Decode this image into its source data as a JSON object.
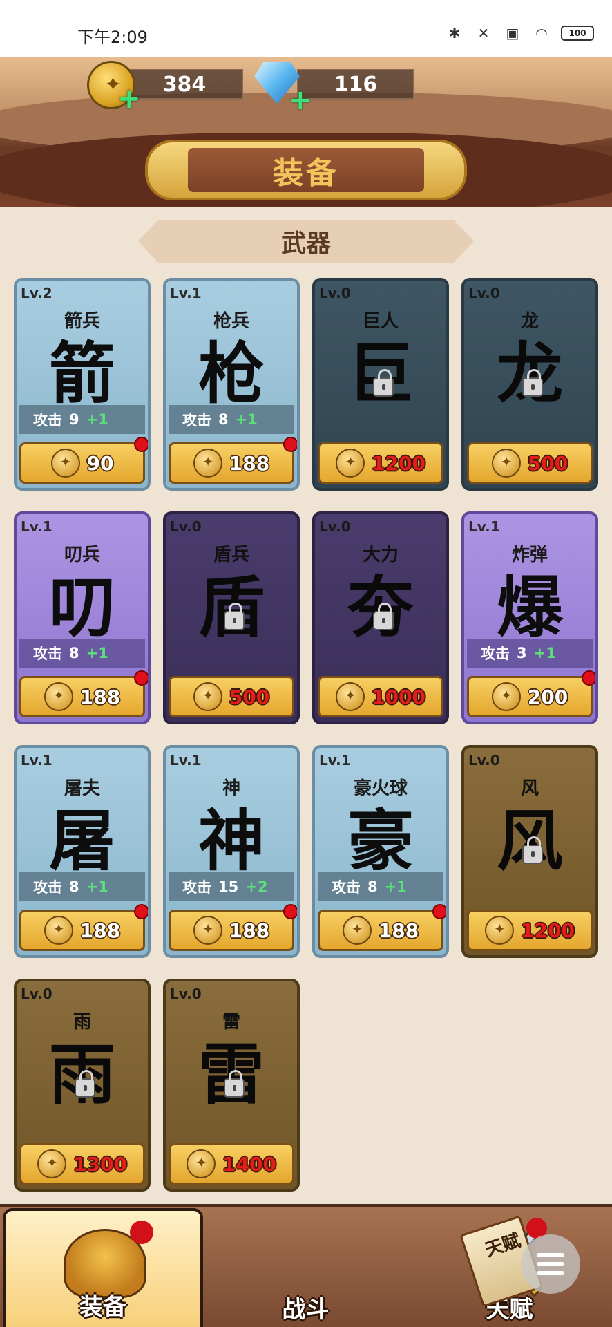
{
  "status_bar": {
    "time": "下午2:09",
    "battery": "100"
  },
  "header": {
    "coins": "384",
    "gems": "116",
    "title": "装备",
    "section": "武器"
  },
  "cards": [
    {
      "level": "Lv.2",
      "name": "箭兵",
      "glyph": "箭",
      "attack_label": "攻击",
      "attack": "9",
      "bonus": "+1",
      "price": "90",
      "locked": false,
      "color": "blue"
    },
    {
      "level": "Lv.1",
      "name": "枪兵",
      "glyph": "枪",
      "attack_label": "攻击",
      "attack": "8",
      "bonus": "+1",
      "price": "188",
      "locked": false,
      "color": "blue"
    },
    {
      "level": "Lv.0",
      "name": "巨人",
      "glyph": "巨",
      "price": "1200",
      "locked": true,
      "color": "blue"
    },
    {
      "level": "Lv.0",
      "name": "龙",
      "glyph": "龙",
      "price": "500",
      "locked": true,
      "color": "blue"
    },
    {
      "level": "Lv.1",
      "name": "叨兵",
      "glyph": "叨",
      "attack_label": "攻击",
      "attack": "8",
      "bonus": "+1",
      "price": "188",
      "locked": false,
      "color": "purple"
    },
    {
      "level": "Lv.0",
      "name": "盾兵",
      "glyph": "盾",
      "price": "500",
      "locked": true,
      "color": "purple"
    },
    {
      "level": "Lv.0",
      "name": "大力",
      "glyph": "夯",
      "price": "1000",
      "locked": true,
      "color": "purple"
    },
    {
      "level": "Lv.1",
      "name": "炸弹",
      "glyph": "爆",
      "attack_label": "攻击",
      "attack": "3",
      "bonus": "+1",
      "price": "200",
      "locked": false,
      "color": "purple"
    },
    {
      "level": "Lv.1",
      "name": "屠夫",
      "glyph": "屠",
      "attack_label": "攻击",
      "attack": "8",
      "bonus": "+1",
      "price": "188",
      "locked": false,
      "color": "blue"
    },
    {
      "level": "Lv.1",
      "name": "神",
      "glyph": "神",
      "attack_label": "攻击",
      "attack": "15",
      "bonus": "+2",
      "price": "188",
      "locked": false,
      "color": "blue"
    },
    {
      "level": "Lv.1",
      "name": "豪火球",
      "glyph": "豪",
      "attack_label": "攻击",
      "attack": "8",
      "bonus": "+1",
      "price": "188",
      "locked": false,
      "color": "blue"
    },
    {
      "level": "Lv.0",
      "name": "风",
      "glyph": "风",
      "price": "1200",
      "locked": true,
      "color": "gold"
    },
    {
      "level": "Lv.0",
      "name": "雨",
      "glyph": "雨",
      "price": "1300",
      "locked": true,
      "color": "gold"
    },
    {
      "level": "Lv.0",
      "name": "雷",
      "glyph": "雷",
      "price": "1400",
      "locked": true,
      "color": "gold"
    }
  ],
  "nav": {
    "tabs": [
      {
        "label": "装备",
        "active": true
      },
      {
        "label": "战斗",
        "active": false
      },
      {
        "label": "天赋",
        "active": false
      }
    ],
    "scroll_text": "天赋"
  },
  "colors": {
    "price_locked": "#e41c1c",
    "bonus": "#5ce07a",
    "title_text": "#f3c45c"
  }
}
